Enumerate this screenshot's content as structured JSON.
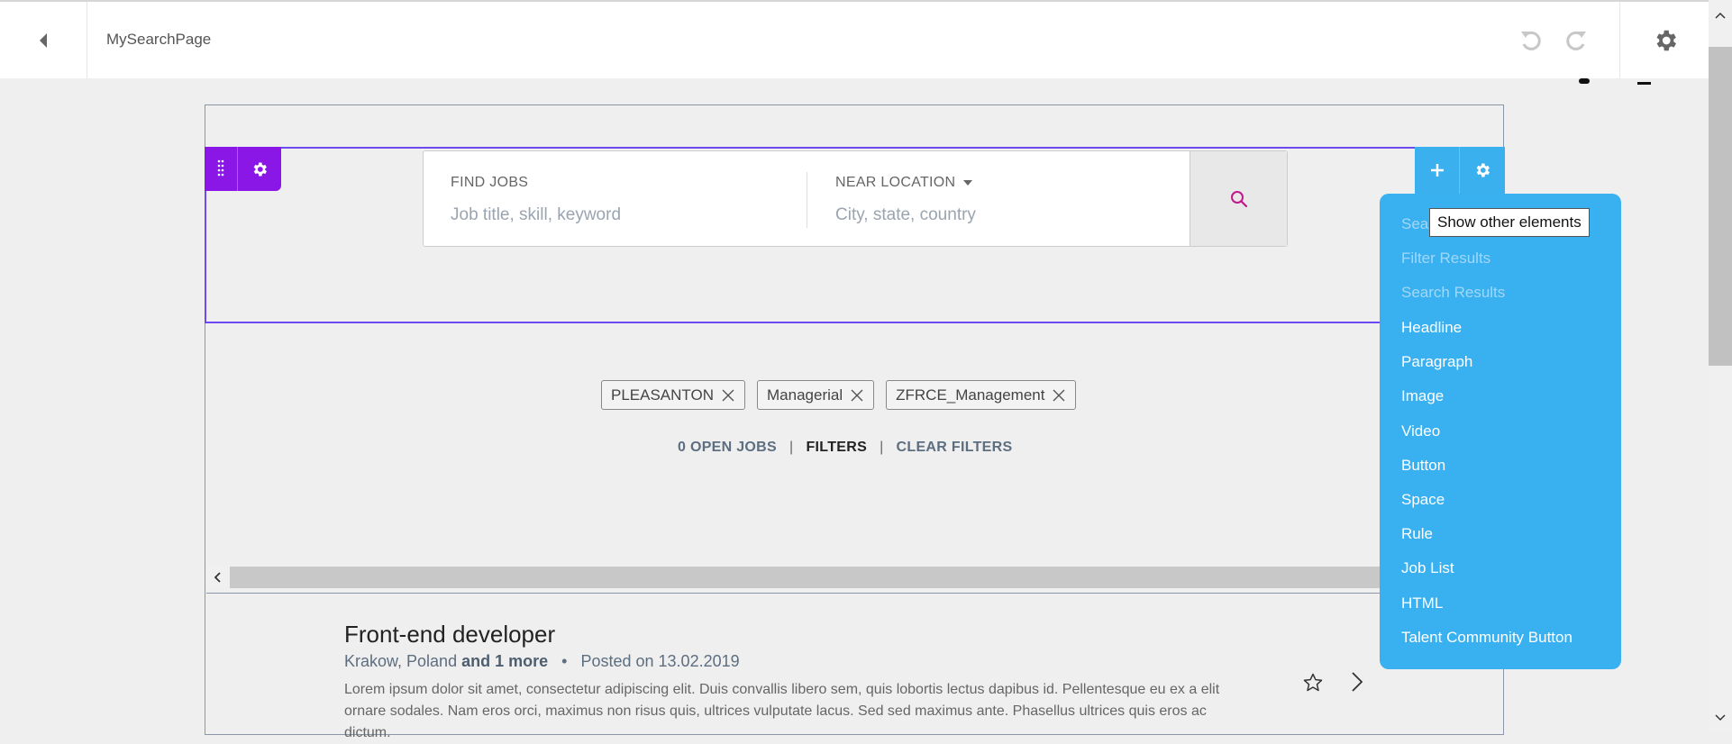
{
  "header": {
    "title": "MySearchPage"
  },
  "search": {
    "find_label": "FIND JOBS",
    "find_placeholder": "Job title, skill, keyword",
    "location_label": "NEAR LOCATION",
    "location_placeholder": "City, state, country"
  },
  "tags": [
    {
      "label": "PLEASANTON"
    },
    {
      "label": "Managerial"
    },
    {
      "label": "ZFRCE_Management"
    }
  ],
  "summary": {
    "open_jobs": "0 OPEN JOBS",
    "filters": "FILTERS",
    "clear_filters": "CLEAR FILTERS"
  },
  "job": {
    "title": "Front-end developer",
    "location": "Krakow, Poland",
    "more": "and 1 more",
    "separator": "•",
    "posted": "Posted on 13.02.2019",
    "description": "Lorem ipsum dolor sit amet, consectetur adipiscing elit. Duis convallis libero sem, quis lobortis lectus dapibus id. Pellentesque eu ex a elit ornare sodales. Nam eros orci, maximus non risus quis, ultrices vulputate lacus. Sed sed maximus ante. Phasellus ultrices quis eros ac dictum."
  },
  "elements_menu": {
    "tooltip": "Show other elements",
    "items": [
      {
        "label": "Sea",
        "disabled": true
      },
      {
        "label": "Filter Results",
        "disabled": true
      },
      {
        "label": "Search Results",
        "disabled": true
      },
      {
        "label": "Headline",
        "disabled": false
      },
      {
        "label": "Paragraph",
        "disabled": false
      },
      {
        "label": "Image",
        "disabled": false
      },
      {
        "label": "Video",
        "disabled": false
      },
      {
        "label": "Button",
        "disabled": false
      },
      {
        "label": "Space",
        "disabled": false
      },
      {
        "label": "Rule",
        "disabled": false
      },
      {
        "label": "Job List",
        "disabled": false
      },
      {
        "label": "HTML",
        "disabled": false
      },
      {
        "label": "Talent Community Button",
        "disabled": false
      }
    ]
  },
  "colors": {
    "accent_purple": "#8a17e6",
    "accent_blue": "#39b0ef",
    "search_icon": "#c2188b"
  },
  "icons": {
    "back": "caret-left-icon",
    "undo": "undo-icon",
    "redo": "redo-icon",
    "settings": "gear-icon",
    "drag": "drag-handle-icon",
    "add": "plus-icon",
    "search": "search-icon",
    "remove": "close-icon",
    "favorite": "star-outline-icon",
    "open": "chevron-right-icon"
  }
}
